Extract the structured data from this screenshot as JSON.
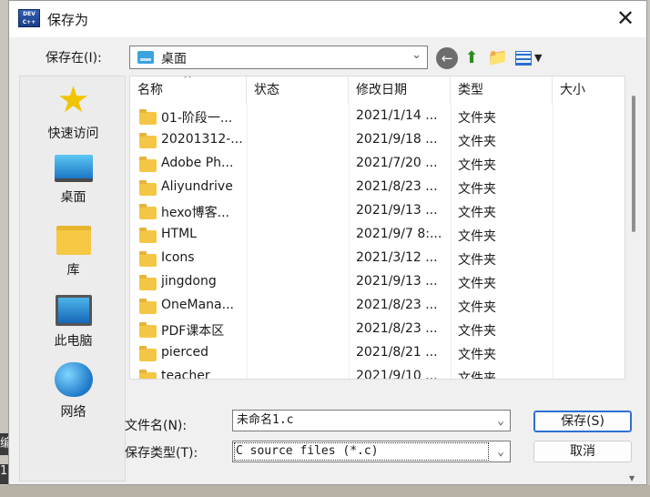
{
  "dialog": {
    "title": "保存为",
    "close_glyph": "✕",
    "app_icon_text": "DEV C++"
  },
  "location": {
    "label": "保存在(I):",
    "value": "桌面"
  },
  "places": [
    {
      "label": "快速访问",
      "icon": "star-icon"
    },
    {
      "label": "桌面",
      "icon": "desktop-icon"
    },
    {
      "label": "库",
      "icon": "library-icon"
    },
    {
      "label": "此电脑",
      "icon": "computer-icon"
    },
    {
      "label": "网络",
      "icon": "network-icon"
    }
  ],
  "columns": {
    "name": "名称",
    "status": "状态",
    "modified": "修改日期",
    "type": "类型",
    "size": "大小"
  },
  "files": [
    {
      "name": "01-阶段一...",
      "date": "2021/1/14 ...",
      "type": "文件夹"
    },
    {
      "name": "20201312-...",
      "date": "2021/9/18 ...",
      "type": "文件夹"
    },
    {
      "name": "Adobe Ph...",
      "date": "2021/7/20 ...",
      "type": "文件夹"
    },
    {
      "name": "Aliyundrive",
      "date": "2021/8/23 ...",
      "type": "文件夹"
    },
    {
      "name": "hexo博客...",
      "date": "2021/9/13 ...",
      "type": "文件夹"
    },
    {
      "name": "HTML",
      "date": "2021/9/7 8:...",
      "type": "文件夹"
    },
    {
      "name": "Icons",
      "date": "2021/3/12 ...",
      "type": "文件夹"
    },
    {
      "name": "jingdong",
      "date": "2021/9/13 ...",
      "type": "文件夹"
    },
    {
      "name": "OneMana...",
      "date": "2021/8/23 ...",
      "type": "文件夹"
    },
    {
      "name": "PDF课本区",
      "date": "2021/8/23 ...",
      "type": "文件夹"
    },
    {
      "name": "pierced",
      "date": "2021/8/21 ...",
      "type": "文件夹"
    },
    {
      "name": "teacher",
      "date": "2021/9/10 ...",
      "type": "文件夹"
    }
  ],
  "filename": {
    "label": "文件名(N):",
    "value": "未命名1.c"
  },
  "filetype": {
    "label": "保存类型(T):",
    "value": "C source files (*.c)"
  },
  "buttons": {
    "save": "保存(S)",
    "cancel": "取消"
  },
  "background": {
    "left_text_1": "编",
    "left_text_2": "1"
  }
}
